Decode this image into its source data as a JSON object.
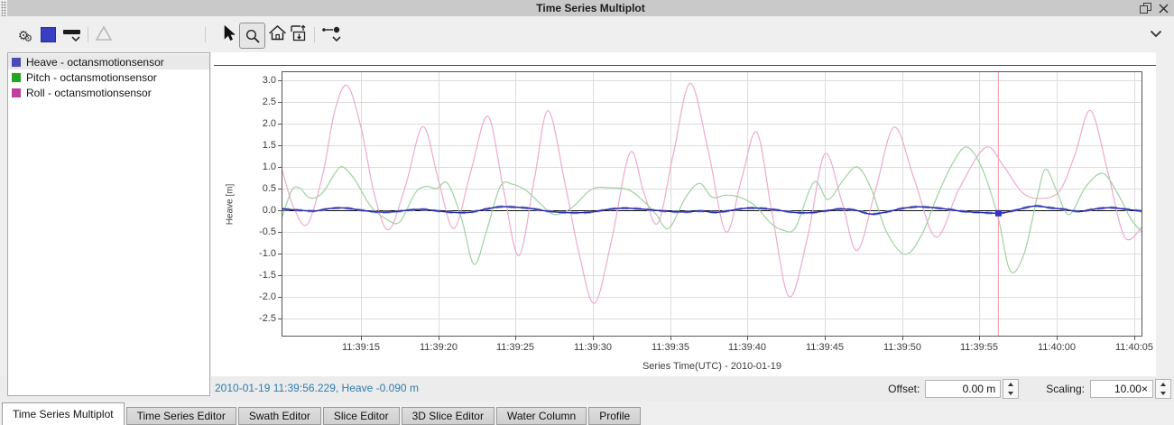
{
  "window": {
    "title": "Time Series Multiplot",
    "accent_color": "#2e7cab",
    "titlebar_color": "#c9c9c9"
  },
  "toolbar": {
    "icons": [
      "settings-gears-icon",
      "series-color-swatch",
      "line-style-dropdown",
      "triangle-marker-disabled",
      "pointer-tool",
      "zoom-tool-active",
      "home-reset-view",
      "fit-vertical-scale",
      "plot-options-dropdown",
      "collapse-toolbar-chevron"
    ]
  },
  "legend": {
    "items": [
      {
        "label": "Heave - octansmotionsensor",
        "color": "#4a4ab9",
        "selected": true
      },
      {
        "label": "Pitch - octansmotionsensor",
        "color": "#1fa81f",
        "selected": false
      },
      {
        "label": "Roll - octansmotionsensor",
        "color": "#bf3f9f",
        "selected": false
      }
    ]
  },
  "chart_data": {
    "type": "line",
    "title": "",
    "xlabel": "Series Time(UTC) - 2010-01-19",
    "ylabel": "Heave [m]",
    "x_unit": "seconds after 11:39:00 UTC",
    "xlim": [
      9.85,
      65.55
    ],
    "ylim": [
      -2.92,
      3.21
    ],
    "grid": true,
    "grid_color": "#dcdcdc",
    "border_color": "#555555",
    "zero_line_color": "#111111",
    "yticks": [
      3.0,
      2.5,
      2.0,
      1.5,
      1.0,
      0.5,
      0.0,
      -0.5,
      -1.0,
      -1.5,
      -2.0,
      -2.5
    ],
    "xticks": [
      {
        "t": 15,
        "label": "11:39:15"
      },
      {
        "t": 20,
        "label": "11:39:20"
      },
      {
        "t": 25,
        "label": "11:39:25"
      },
      {
        "t": 30,
        "label": "11:39:30"
      },
      {
        "t": 35,
        "label": "11:39:35"
      },
      {
        "t": 40,
        "label": "11:39:40"
      },
      {
        "t": 45,
        "label": "11:39:45"
      },
      {
        "t": 50,
        "label": "11:39:50"
      },
      {
        "t": 55,
        "label": "11:39:55"
      },
      {
        "t": 60,
        "label": "11:40:00"
      },
      {
        "t": 65,
        "label": "11:40:05"
      }
    ],
    "series": [
      {
        "name": "Heave - octansmotionsensor",
        "color": "#2b2ba8",
        "width": 1.5,
        "underlay": {
          "color": "#99a5e0",
          "width": 3.2,
          "dash": "8 6"
        },
        "points": [
          [
            9.9,
            0.03
          ],
          [
            11,
            0.0
          ],
          [
            12,
            -0.02
          ],
          [
            13,
            0.04
          ],
          [
            14,
            0.05
          ],
          [
            15,
            0.0
          ],
          [
            16,
            -0.04
          ],
          [
            17,
            -0.04
          ],
          [
            18,
            0.0
          ],
          [
            19,
            0.02
          ],
          [
            20,
            -0.02
          ],
          [
            21,
            -0.05
          ],
          [
            22,
            -0.05
          ],
          [
            23,
            0.02
          ],
          [
            24,
            0.08
          ],
          [
            25,
            0.07
          ],
          [
            26,
            0.04
          ],
          [
            27,
            -0.02
          ],
          [
            28,
            -0.05
          ],
          [
            29,
            -0.06
          ],
          [
            30,
            -0.04
          ],
          [
            31,
            0.02
          ],
          [
            32,
            0.05
          ],
          [
            33,
            0.03
          ],
          [
            34,
            0.0
          ],
          [
            35,
            -0.03
          ],
          [
            36,
            -0.04
          ],
          [
            37,
            -0.02
          ],
          [
            38,
            -0.05
          ],
          [
            39,
            0.0
          ],
          [
            40,
            0.05
          ],
          [
            41,
            0.04
          ],
          [
            42,
            0.0
          ],
          [
            43,
            -0.05
          ],
          [
            44,
            -0.06
          ],
          [
            45,
            -0.02
          ],
          [
            46,
            0.03
          ],
          [
            47,
            0.0
          ],
          [
            48,
            -0.09
          ],
          [
            49,
            -0.04
          ],
          [
            50,
            0.04
          ],
          [
            51,
            0.08
          ],
          [
            52,
            0.06
          ],
          [
            53,
            0.02
          ],
          [
            54,
            -0.03
          ],
          [
            55,
            -0.05
          ],
          [
            56.2,
            -0.07
          ],
          [
            57,
            -0.03
          ],
          [
            58,
            0.06
          ],
          [
            58.7,
            0.1
          ],
          [
            59.5,
            0.06
          ],
          [
            60.5,
            0.02
          ],
          [
            61.5,
            -0.03
          ],
          [
            62.5,
            0.03
          ],
          [
            63.5,
            0.06
          ],
          [
            64.3,
            0.03
          ],
          [
            65.5,
            -0.02
          ]
        ]
      },
      {
        "name": "Pitch - octansmotionsensor",
        "color": "#9fd29f",
        "width": 1.2,
        "points": [
          [
            9.9,
            -0.15
          ],
          [
            10.5,
            0.45
          ],
          [
            11.0,
            0.52
          ],
          [
            11.7,
            0.28
          ],
          [
            12.5,
            0.4
          ],
          [
            13.3,
            0.85
          ],
          [
            13.8,
            1.0
          ],
          [
            14.6,
            0.7
          ],
          [
            15.6,
            0.1
          ],
          [
            16.6,
            -0.2
          ],
          [
            17.5,
            -0.27
          ],
          [
            18.5,
            0.4
          ],
          [
            19.2,
            0.55
          ],
          [
            19.9,
            0.5
          ],
          [
            20.6,
            0.62
          ],
          [
            21.5,
            -0.2
          ],
          [
            22.3,
            -1.25
          ],
          [
            23.1,
            -0.5
          ],
          [
            24.0,
            0.55
          ],
          [
            24.8,
            0.6
          ],
          [
            25.7,
            0.45
          ],
          [
            26.6,
            0.15
          ],
          [
            27.5,
            -0.1
          ],
          [
            28.6,
            0.05
          ],
          [
            29.9,
            0.48
          ],
          [
            31.0,
            0.52
          ],
          [
            32.3,
            0.47
          ],
          [
            33.3,
            0.2
          ],
          [
            34.1,
            -0.1
          ],
          [
            34.9,
            -0.42
          ],
          [
            36.0,
            0.3
          ],
          [
            36.9,
            0.62
          ],
          [
            37.7,
            0.3
          ],
          [
            38.6,
            0.35
          ],
          [
            39.5,
            0.3
          ],
          [
            40.5,
            0.1
          ],
          [
            41.5,
            -0.3
          ],
          [
            42.3,
            -0.46
          ],
          [
            43.1,
            -0.4
          ],
          [
            44.3,
            0.65
          ],
          [
            45.2,
            0.25
          ],
          [
            46.2,
            0.7
          ],
          [
            47.1,
            1.0
          ],
          [
            48.0,
            0.5
          ],
          [
            49.0,
            -0.5
          ],
          [
            50.2,
            -1.02
          ],
          [
            51.3,
            -0.55
          ],
          [
            52.3,
            0.35
          ],
          [
            53.3,
            1.1
          ],
          [
            54.2,
            1.46
          ],
          [
            55.2,
            0.95
          ],
          [
            56.2,
            -0.15
          ],
          [
            57.0,
            -1.4
          ],
          [
            57.9,
            -1.0
          ],
          [
            58.8,
            0.4
          ],
          [
            59.3,
            0.95
          ],
          [
            60.0,
            0.45
          ],
          [
            60.8,
            -0.1
          ],
          [
            61.9,
            0.55
          ],
          [
            63.0,
            0.85
          ],
          [
            64.0,
            0.35
          ],
          [
            64.8,
            -0.2
          ],
          [
            65.5,
            -0.5
          ]
        ]
      },
      {
        "name": "Roll - octansmotionsensor",
        "color": "#edaace",
        "width": 1.2,
        "points": [
          [
            9.9,
            0.92
          ],
          [
            10.6,
            0.1
          ],
          [
            11.5,
            -0.33
          ],
          [
            12.5,
            0.8
          ],
          [
            13.3,
            2.3
          ],
          [
            14.1,
            2.88
          ],
          [
            15.0,
            1.9
          ],
          [
            15.9,
            0.3
          ],
          [
            16.8,
            -0.45
          ],
          [
            17.9,
            0.6
          ],
          [
            19.0,
            1.93
          ],
          [
            20.0,
            0.7
          ],
          [
            21.0,
            -0.42
          ],
          [
            22.1,
            0.9
          ],
          [
            23.2,
            2.17
          ],
          [
            24.2,
            0.5
          ],
          [
            25.2,
            -1.05
          ],
          [
            26.2,
            0.7
          ],
          [
            27.1,
            2.3
          ],
          [
            28.2,
            0.6
          ],
          [
            29.1,
            -1.0
          ],
          [
            30.1,
            -2.15
          ],
          [
            31.2,
            -0.7
          ],
          [
            32.4,
            1.33
          ],
          [
            33.3,
            0.4
          ],
          [
            34.2,
            -0.3
          ],
          [
            35.2,
            1.3
          ],
          [
            36.3,
            2.93
          ],
          [
            37.5,
            1.3
          ],
          [
            38.6,
            -0.5
          ],
          [
            39.6,
            0.7
          ],
          [
            40.6,
            1.8
          ],
          [
            41.6,
            -0.1
          ],
          [
            42.7,
            -2.0
          ],
          [
            43.9,
            -0.6
          ],
          [
            45.0,
            1.3
          ],
          [
            46.1,
            0.2
          ],
          [
            47.1,
            -0.93
          ],
          [
            48.3,
            0.5
          ],
          [
            49.5,
            1.92
          ],
          [
            50.8,
            0.7
          ],
          [
            52.2,
            -0.62
          ],
          [
            53.7,
            0.5
          ],
          [
            55.4,
            1.45
          ],
          [
            56.6,
            1.0
          ],
          [
            57.8,
            0.4
          ],
          [
            59.0,
            0.27
          ],
          [
            60.2,
            0.45
          ],
          [
            61.2,
            1.3
          ],
          [
            62.2,
            2.3
          ],
          [
            63.3,
            0.9
          ],
          [
            64.4,
            -0.62
          ],
          [
            65.5,
            -0.4
          ]
        ]
      }
    ],
    "cursor": {
      "t": 56.229,
      "time_label": "11:39:56.229",
      "line_color": "#f2a9b6",
      "marker_series": "Heave - octansmotionsensor",
      "marker_value": -0.07,
      "marker_color": "#3434bc",
      "marker_size": 7
    },
    "legend_position": "top-left-panel"
  },
  "status": {
    "text": "2010-01-19 11:39:56.229, Heave -0.090 m"
  },
  "controls": {
    "offset_label": "Offset:",
    "offset_value": "0.00 m",
    "scaling_label": "Scaling:",
    "scaling_value": "10.00×"
  },
  "tabs": [
    {
      "label": "Time Series Multiplot",
      "active": true
    },
    {
      "label": "Time Series Editor",
      "active": false
    },
    {
      "label": "Swath Editor",
      "active": false
    },
    {
      "label": "Slice Editor",
      "active": false
    },
    {
      "label": "3D Slice Editor",
      "active": false
    },
    {
      "label": "Water Column",
      "active": false
    },
    {
      "label": "Profile",
      "active": false
    }
  ]
}
